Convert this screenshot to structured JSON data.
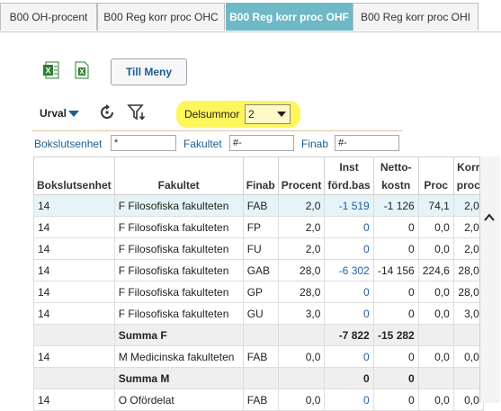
{
  "tabs": [
    {
      "label": "B00 OH-procent",
      "active": false
    },
    {
      "label": "B00 Reg korr proc OHC",
      "active": false
    },
    {
      "label": "B00 Reg korr proc OHF",
      "active": true
    },
    {
      "label": "B00 Reg korr proc OHI",
      "active": false
    }
  ],
  "toolbar": {
    "excel_icon": "excel-icon",
    "export_icon": "export-excel-icon",
    "menu_button": "Till Meny",
    "urval_label": "Urval",
    "reset_icon": "refresh-icon",
    "filter_icon": "filter-icon",
    "delsummor_label": "Delsummor",
    "delsummor_value": "2",
    "highlight_color": "#fff54a"
  },
  "filters": {
    "bokslutsenhet_label": "Bokslutsenhet",
    "bokslutsenhet_value": "*",
    "fakultet_label": "Fakultet",
    "fakultet_value": "#-",
    "finab_label": "Finab",
    "finab_value": "#-"
  },
  "table": {
    "headers": {
      "bokslutsenhet": "Bokslutsenhet",
      "fakultet": "Fakultet",
      "finab": "Finab",
      "procent": "Procent",
      "inst_1": "Inst",
      "inst_2": "förd.bas",
      "netto_1": "Netto-",
      "netto_2": "kostn",
      "proc": "Proc",
      "korr_1": "Korr",
      "korr_2": "proc"
    },
    "rows": [
      {
        "type": "data",
        "hl": true,
        "bokslutsenhet": "14",
        "fakultet": "F Filosofiska fakulteten",
        "finab": "FAB",
        "procent": "2,0",
        "inst": "-1 519",
        "netto": "-1 126",
        "proc": "74,1",
        "korr": "2,0"
      },
      {
        "type": "data",
        "hl": false,
        "bokslutsenhet": "14",
        "fakultet": "F Filosofiska fakulteten",
        "finab": "FP",
        "procent": "2,0",
        "inst": "0",
        "netto": "0",
        "proc": "0,0",
        "korr": "2,0"
      },
      {
        "type": "data",
        "hl": false,
        "bokslutsenhet": "14",
        "fakultet": "F Filosofiska fakulteten",
        "finab": "FU",
        "procent": "2,0",
        "inst": "0",
        "netto": "0",
        "proc": "0,0",
        "korr": "2,0"
      },
      {
        "type": "data",
        "hl": false,
        "bokslutsenhet": "14",
        "fakultet": "F Filosofiska fakulteten",
        "finab": "GAB",
        "procent": "28,0",
        "inst": "-6 302",
        "netto": "-14 156",
        "proc": "224,6",
        "korr": "28,0"
      },
      {
        "type": "data",
        "hl": false,
        "bokslutsenhet": "14",
        "fakultet": "F Filosofiska fakulteten",
        "finab": "GP",
        "procent": "28,0",
        "inst": "0",
        "netto": "0",
        "proc": "0,0",
        "korr": "28,0"
      },
      {
        "type": "data",
        "hl": false,
        "bokslutsenhet": "14",
        "fakultet": "F Filosofiska fakulteten",
        "finab": "GU",
        "procent": "3,0",
        "inst": "0",
        "netto": "0",
        "proc": "0,0",
        "korr": "3,0"
      },
      {
        "type": "sum",
        "label": "Summa F",
        "inst": "-7 822",
        "netto": "-15 282"
      },
      {
        "type": "data",
        "hl": false,
        "bokslutsenhet": "14",
        "fakultet": "M Medicinska fakulteten",
        "finab": "FAB",
        "procent": "0,0",
        "inst": "0",
        "netto": "0",
        "proc": "0,0",
        "korr": "0,0"
      },
      {
        "type": "sum",
        "label": "Summa M",
        "inst": "0",
        "netto": "0"
      },
      {
        "type": "data",
        "hl": false,
        "bokslutsenhet": "14",
        "fakultet": "O Ofördelat",
        "finab": "FAB",
        "procent": "0,0",
        "inst": "0",
        "netto": "0",
        "proc": "0,0",
        "korr": "0,0"
      }
    ]
  },
  "scrollbar": {
    "up_icon": "chevron-up-icon"
  }
}
